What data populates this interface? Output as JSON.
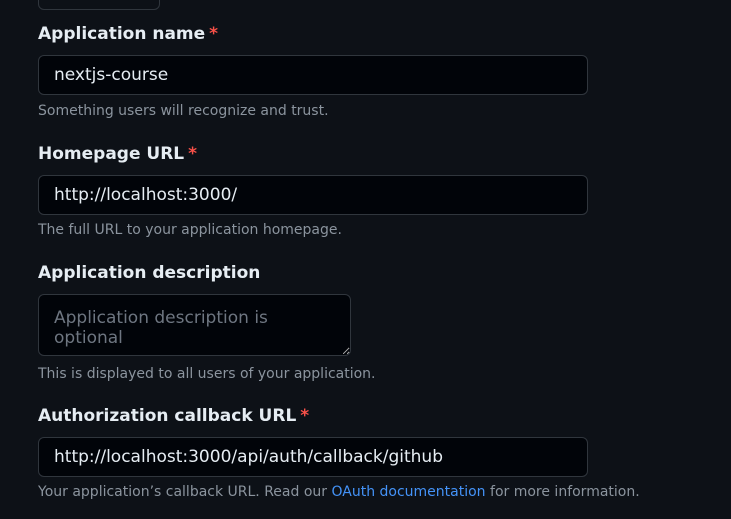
{
  "app_name": {
    "label": "Application name",
    "required_mark": "*",
    "value": "nextjs-course",
    "hint": "Something users will recognize and trust."
  },
  "homepage": {
    "label": "Homepage URL",
    "required_mark": "*",
    "value": "http://localhost:3000/",
    "hint": "The full URL to your application homepage."
  },
  "description": {
    "label": "Application description",
    "placeholder": "Application description is optional",
    "hint": "This is displayed to all users of your application."
  },
  "callback": {
    "label": "Authorization callback URL",
    "required_mark": "*",
    "value": "http://localhost:3000/api/auth/callback/github",
    "hint_before": "Your application’s callback URL. Read our ",
    "hint_link": "OAuth documentation",
    "hint_after": " for more information."
  },
  "colors": {
    "background": "#0d1117",
    "input_background": "#010409",
    "border": "#30363d",
    "required": "#f85149",
    "link": "#4493f8",
    "muted": "#8b949e"
  }
}
